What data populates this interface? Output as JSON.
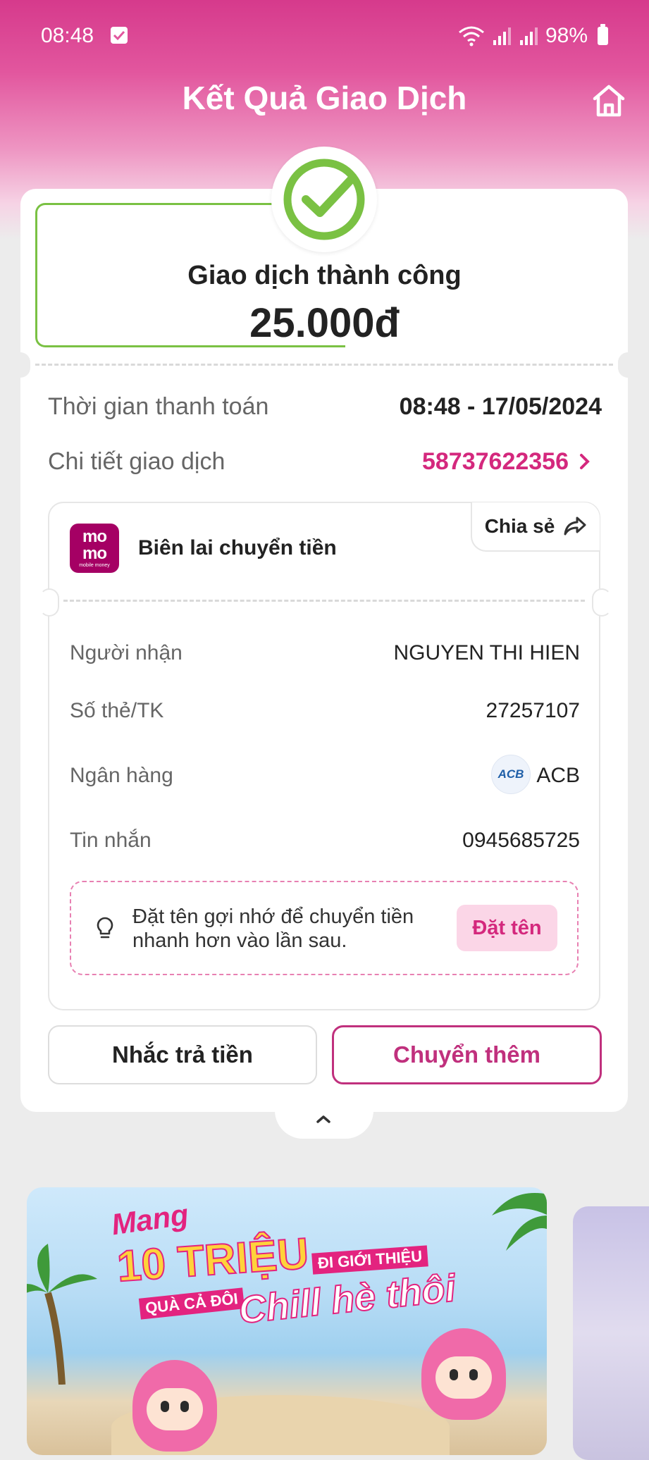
{
  "status_bar": {
    "time": "08:48",
    "battery": "98%"
  },
  "header": {
    "title": "Kết Quả Giao Dịch"
  },
  "result": {
    "status": "Giao dịch thành công",
    "amount": "25.000đ"
  },
  "details": {
    "time_label": "Thời gian thanh toán",
    "time_value": "08:48 - 17/05/2024",
    "detail_label": "Chi tiết giao dịch",
    "detail_value": "58737622356"
  },
  "receipt": {
    "logo_text_1": "mo",
    "logo_text_2": "mo",
    "logo_sub": "mobile money",
    "title": "Biên lai chuyển tiền",
    "share_label": "Chia sẻ",
    "rows": [
      {
        "label": "Người nhận",
        "value": "NGUYEN THI HIEN"
      },
      {
        "label": "Số thẻ/TK",
        "value": "27257107"
      },
      {
        "label": "Ngân hàng",
        "value": "ACB"
      },
      {
        "label": "Tin nhắn",
        "value": "0945685725"
      }
    ],
    "bank_logo_text": "ACB",
    "tip_text": "Đặt tên gợi nhớ để chuyển tiền nhanh hơn vào lần sau.",
    "tip_button": "Đặt tên"
  },
  "actions": {
    "remind_label": "Nhắc trả tiền",
    "transfer_more_label": "Chuyển thêm"
  },
  "banner": {
    "line1": "Mang",
    "line2": "10 TRIỆU",
    "line3": "ĐI GIỚI THIỆU",
    "line4": "QUÀ CẢ ĐÔI",
    "line5": "Chill hè thôi"
  },
  "colors": {
    "brand_pink": "#d4287d",
    "success_green": "#7ac143"
  },
  "icons": {
    "home": "home-icon",
    "check": "check-circle-icon",
    "share": "share-arrow-icon",
    "bulb": "lightbulb-icon",
    "chevron_right": "chevron-right-icon",
    "chevron_up": "chevron-up-icon"
  }
}
